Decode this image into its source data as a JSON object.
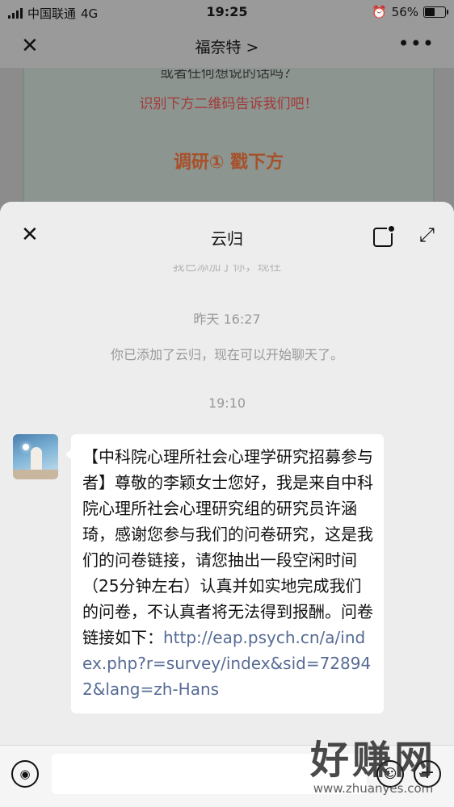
{
  "status_bar": {
    "carrier": "中国联通",
    "network": "4G",
    "time": "19:25",
    "battery": "56%",
    "battery_level": 0.56
  },
  "top_nav": {
    "title": "福奈特 >",
    "close_icon": "close-icon",
    "more_icon": "more-icon"
  },
  "background_article": {
    "partial_line": "或者任何想说的话吗？",
    "red_line": "识别下方二维码告诉我们吧！",
    "orange_line": "调研① 戳下方"
  },
  "chat_sheet": {
    "title": "云归",
    "close_icon": "close-icon",
    "float_icon": "float-window-icon",
    "expand_icon": "expand-icon",
    "cut_off_text": "我已添加了你，现在",
    "timestamp_1": "昨天 16:27",
    "system_message": "你已添加了云归，现在可以开始聊天了。",
    "timestamp_2": "19:10",
    "message": {
      "heading": "【中科院心理所社会心理学研究招募参与者】",
      "body": "尊敬的李颖女士您好，我是来自中科院心理所社会心理研究组的研究员许涵琦，感谢您参与我们的问卷研究，这是我们的问卷链接，请您抽出一段空闲时间（25分钟左右）认真并如实地完成我们的问卷，不认真者将无法得到报酬。问卷链接如下：",
      "link": "http://eap.psych.cn/a/index.php?r=survey/index&sid=728942&lang=zh-Hans"
    }
  },
  "input_bar": {
    "value": "",
    "placeholder": "",
    "voice_icon": "voice-icon",
    "emoji_icon": "emoji-icon",
    "plus_icon": "plus-icon"
  },
  "watermark": {
    "big": "好赚网",
    "small": "www.zhuanyes.com"
  }
}
